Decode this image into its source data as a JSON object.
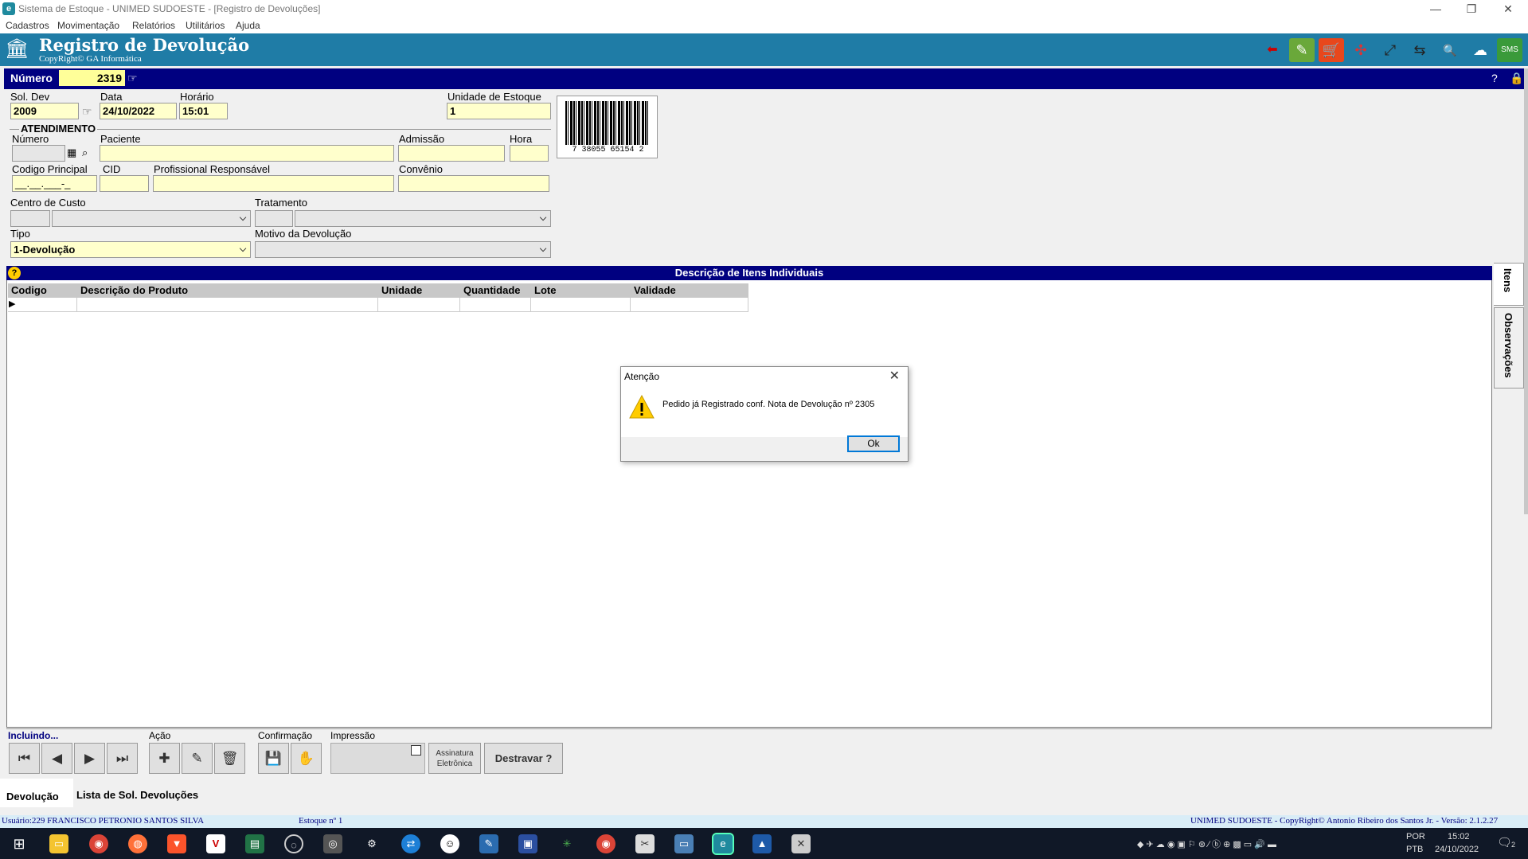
{
  "window": {
    "title": "Sistema de Estoque - UNIMED SUDOESTE - [Registro de Devoluções]",
    "minimize": "—",
    "restore": "❐",
    "close": "✕"
  },
  "menu": [
    "Cadastros",
    "Movimentação",
    "Relatórios",
    "Utilitários",
    "Ajuda"
  ],
  "header": {
    "title": "Registro de Devolução",
    "subtitle": "CopyRight© GA Informática"
  },
  "numero": {
    "label": "Número",
    "value": "2319"
  },
  "form": {
    "sol_dev_label": "Sol. Dev",
    "sol_dev_value": "2009",
    "data_label": "Data",
    "data_value": "24/10/2022",
    "horario_label": "Horário",
    "horario_value": "15:01",
    "unidade_label": "Unidade de Estoque",
    "unidade_value": "1",
    "barcode_digits": "7 38055 65154 2",
    "atendimento_label": "ATENDIMENTO",
    "numero_label": "Número",
    "numero_value": "",
    "paciente_label": "Paciente",
    "admissao_label": "Admissão",
    "hora_label": "Hora",
    "codigo_principal_label": "Codigo Principal",
    "codigo_principal_value": "__.__.___-_",
    "cid_label": "CID",
    "profissional_label": "Profissional Responsável",
    "convenio_label": "Convênio",
    "centro_custo_label": "Centro de Custo",
    "tratamento_label": "Tratamento",
    "tipo_label": "Tipo",
    "tipo_value": "1-Devolução",
    "motivo_label": "Motivo da Devolução",
    "motivo_value": ""
  },
  "grid": {
    "title": "Descrição de Itens Individuais",
    "columns": [
      "Codigo",
      "Descrição do Produto",
      "Unidade",
      "Quantidade",
      "Lote",
      "Validade"
    ]
  },
  "side_tabs": [
    "Itens",
    "Observações"
  ],
  "dialog": {
    "title": "Atenção",
    "message": "Pedido já Registrado conf. Nota de Devolução nº 2305",
    "ok_label": "Ok"
  },
  "bottom": {
    "incluindo_label": "Incluindo...",
    "acao_label": "Ação",
    "confirmacao_label": "Confirmação",
    "impressao_label": "Impressão",
    "assinatura_label_1": "Assinatura",
    "assinatura_label_2": "Eletrônica",
    "destravar_label": "Destravar ?"
  },
  "tabs": [
    "Devolução",
    "Lista de Sol. Devoluções"
  ],
  "status": {
    "usuario": "Usuário:229 FRANCISCO PETRONIO SANTOS SILVA",
    "estoque": "Estoque nº 1",
    "copyright": "UNIMED SUDOESTE - CopyRight© Antonio Ribeiro dos Santos Jr. - Versão: 2.1.2.27"
  },
  "taskbar": {
    "lang1": "POR",
    "lang2": "PTB",
    "time": "15:02",
    "date": "24/10/2022",
    "notif_count": "2"
  },
  "colors": {
    "header_bg": "#1f7ca6",
    "navy": "#000080",
    "field_yellow": "#ffffcc",
    "taskbar": "#101827"
  }
}
